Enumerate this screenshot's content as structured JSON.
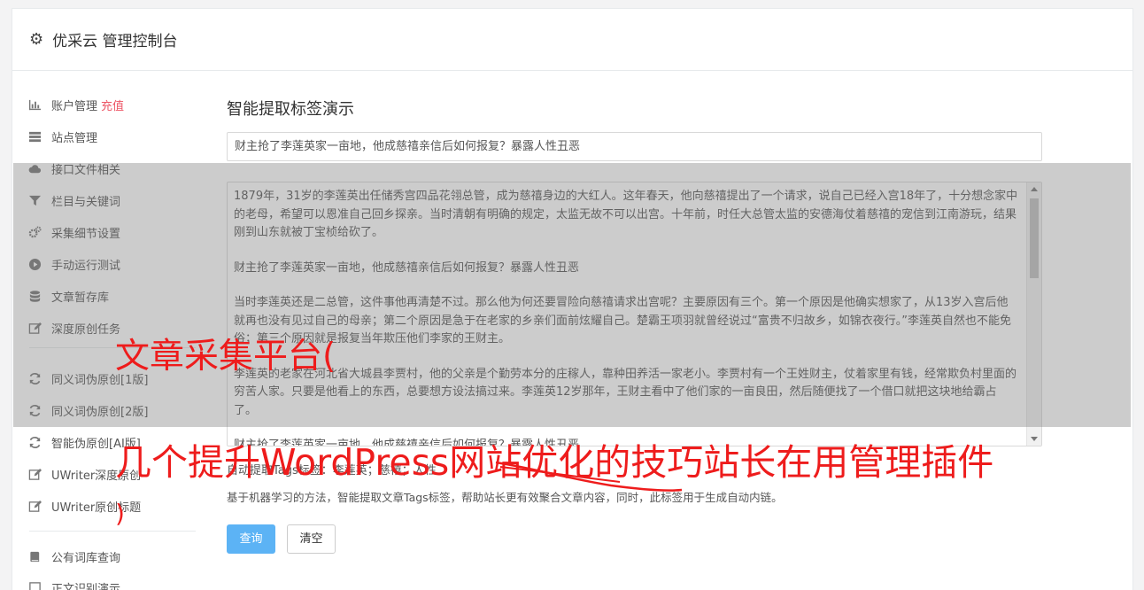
{
  "header": {
    "title": "优采云 管理控制台",
    "icon": "gear-icon"
  },
  "sidebar": {
    "items": [
      {
        "label": "账户管理",
        "extra": "充值",
        "icon": "bar-chart-icon"
      },
      {
        "label": "站点管理",
        "icon": "server-icon"
      },
      {
        "label": "接口文件相关",
        "icon": "cloud-upload-icon"
      },
      {
        "label": "栏目与关键词",
        "icon": "filter-icon"
      },
      {
        "label": "采集细节设置",
        "icon": "cogs-icon"
      },
      {
        "label": "手动运行测试",
        "icon": "play-circle-icon"
      },
      {
        "label": "文章暂存库",
        "icon": "database-icon"
      },
      {
        "label": "深度原创任务",
        "icon": "edit-icon"
      },
      {
        "label": "同义词伪原创[1版]",
        "icon": "refresh-icon"
      },
      {
        "label": "同义词伪原创[2版]",
        "icon": "refresh-icon"
      },
      {
        "label": "智能伪原创[AI版]",
        "icon": "refresh-icon"
      },
      {
        "label": "UWriter深度原创",
        "icon": "edit-icon"
      },
      {
        "label": "UWriter原创标题",
        "icon": "edit-icon"
      },
      {
        "label": "公有词库查询",
        "icon": "book-icon"
      },
      {
        "label": "正文识别演示",
        "icon": "square-icon"
      }
    ]
  },
  "main": {
    "heading": "智能提取标签演示",
    "title_value": "财主抢了李莲英家一亩地，他成慈禧亲信后如何报复？暴露人性丑恶",
    "content_paragraphs": [
      "1879年，31岁的李莲英出任储秀宫四品花翎总管，成为慈禧身边的大红人。这年春天，他向慈禧提出了一个请求，说自己已经入宫18年了，十分想念家中的老母，希望可以恩准自己回乡探亲。当时清朝有明确的规定，太监无故不可以出宫。十年前，时任大总管太监的安德海仗着慈禧的宠信到江南游玩，结果刚到山东就被丁宝桢给砍了。",
      "财主抢了李莲英家一亩地，他成慈禧亲信后如何报复？暴露人性丑恶",
      "当时李莲英还是二总管，这件事他再清楚不过。那么他为何还要冒险向慈禧请求出宫呢？主要原因有三个。第一个原因是他确实想家了，从13岁入宫后他就再也没有见过自己的母亲；第二个原因是急于在老家的乡亲们面前炫耀自己。楚霸王项羽就曾经说过“富贵不归故乡，如锦衣夜行。”李莲英自然也不能免俗；第三个原因就是报复当年欺压他们李家的王财主。",
      "李莲英的老家在河北省大城县李贾村，他的父亲是个勤劳本分的庄稼人，靠种田养活一家老小。李贾村有一个王姓财主，仗着家里有钱，经常欺负村里面的穷苦人家。只要是他看上的东西，总要想方设法搞过来。李莲英12岁那年，王财主看中了他们家的一亩良田，然后随便找了一个借口就把这块地给霸占了。",
      "财主抢了李莲英家一亩地，他成慈禧亲信后如何报复？暴露人性丑恶"
    ],
    "tags_line": "自动提取Tags标签：李莲英；慈禧；人性",
    "description": "基于机器学习的方法，智能提取文章Tags标签，帮助站长更有效聚合文章内容，同时，此标签用于生成自动内链。",
    "query_button": "查询",
    "clear_button": "清空"
  },
  "watermark": {
    "line1": "文章采集平台(",
    "line2": "几个提升WordPress网站优化的技巧站长在用管理插件",
    "line3": ")",
    "color": "#ee1c1c"
  }
}
